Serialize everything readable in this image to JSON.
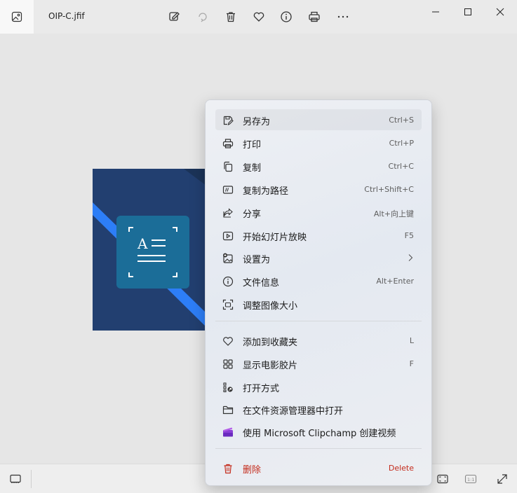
{
  "titlebar": {
    "filename": "OIP-C.jfif"
  },
  "menu": {
    "items": [
      {
        "label": "另存为",
        "shortcut": "Ctrl+S",
        "icon": "save-as-icon"
      },
      {
        "label": "打印",
        "shortcut": "Ctrl+P",
        "icon": "print-icon"
      },
      {
        "label": "复制",
        "shortcut": "Ctrl+C",
        "icon": "copy-icon"
      },
      {
        "label": "复制为路径",
        "shortcut": "Ctrl+Shift+C",
        "icon": "copy-path-icon"
      },
      {
        "label": "分享",
        "shortcut": "Alt+向上键",
        "icon": "share-icon"
      },
      {
        "label": "开始幻灯片放映",
        "shortcut": "F5",
        "icon": "slideshow-icon"
      },
      {
        "label": "设置为",
        "shortcut": "",
        "icon": "set-as-icon"
      },
      {
        "label": "文件信息",
        "shortcut": "Alt+Enter",
        "icon": "info-icon"
      },
      {
        "label": "调整图像大小",
        "shortcut": "",
        "icon": "resize-icon"
      },
      {
        "label": "添加到收藏夹",
        "shortcut": "L",
        "icon": "heart-icon"
      },
      {
        "label": "显示电影胶片",
        "shortcut": "F",
        "icon": "filmstrip-icon"
      },
      {
        "label": "打开方式",
        "shortcut": "",
        "icon": "open-with-icon"
      },
      {
        "label": "在文件资源管理器中打开",
        "shortcut": "",
        "icon": "folder-icon"
      },
      {
        "label": "使用 Microsoft Clipchamp 创建视频",
        "shortcut": "",
        "icon": "clipchamp-icon"
      },
      {
        "label": "删除",
        "shortcut": "Delete",
        "icon": "trash-icon"
      }
    ]
  },
  "colors": {
    "accent_danger": "#c42b1c",
    "image_bg": "#213f6f",
    "image_stripe": "#2f80ff",
    "image_tile": "#1c6e99"
  }
}
